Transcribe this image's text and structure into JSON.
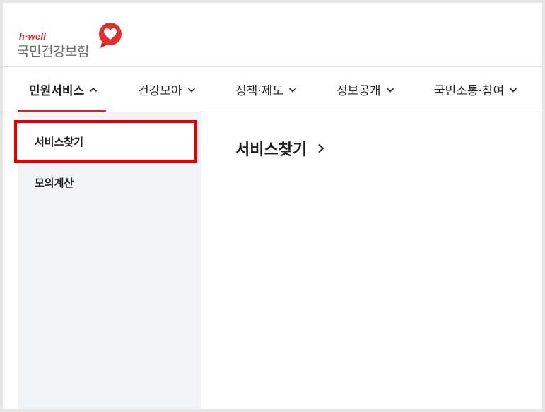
{
  "logo": {
    "tag": "h·well",
    "name": "국민건강보험",
    "mark_icon": "heart-icon",
    "colors": {
      "brand_red": "#e03030",
      "text_gray": "#6b6b6b"
    }
  },
  "gnb": {
    "items": [
      {
        "label": "민원서비스",
        "icon": "chevron-up-icon",
        "active": true
      },
      {
        "label": "건강모아",
        "icon": "chevron-down-icon"
      },
      {
        "label": "정책·제도",
        "icon": "chevron-down-icon"
      },
      {
        "label": "정보공개",
        "icon": "chevron-down-icon"
      },
      {
        "label": "국민소통·참여",
        "icon": "chevron-down-icon"
      }
    ],
    "active_underline_color": "#d6222a"
  },
  "side": {
    "items": [
      {
        "label": "서비스찾기",
        "selected": true
      },
      {
        "label": "모의계산"
      }
    ],
    "highlight_color": "#e00000"
  },
  "content": {
    "title": "서비스찾기",
    "title_icon": "chevron-right-icon"
  }
}
